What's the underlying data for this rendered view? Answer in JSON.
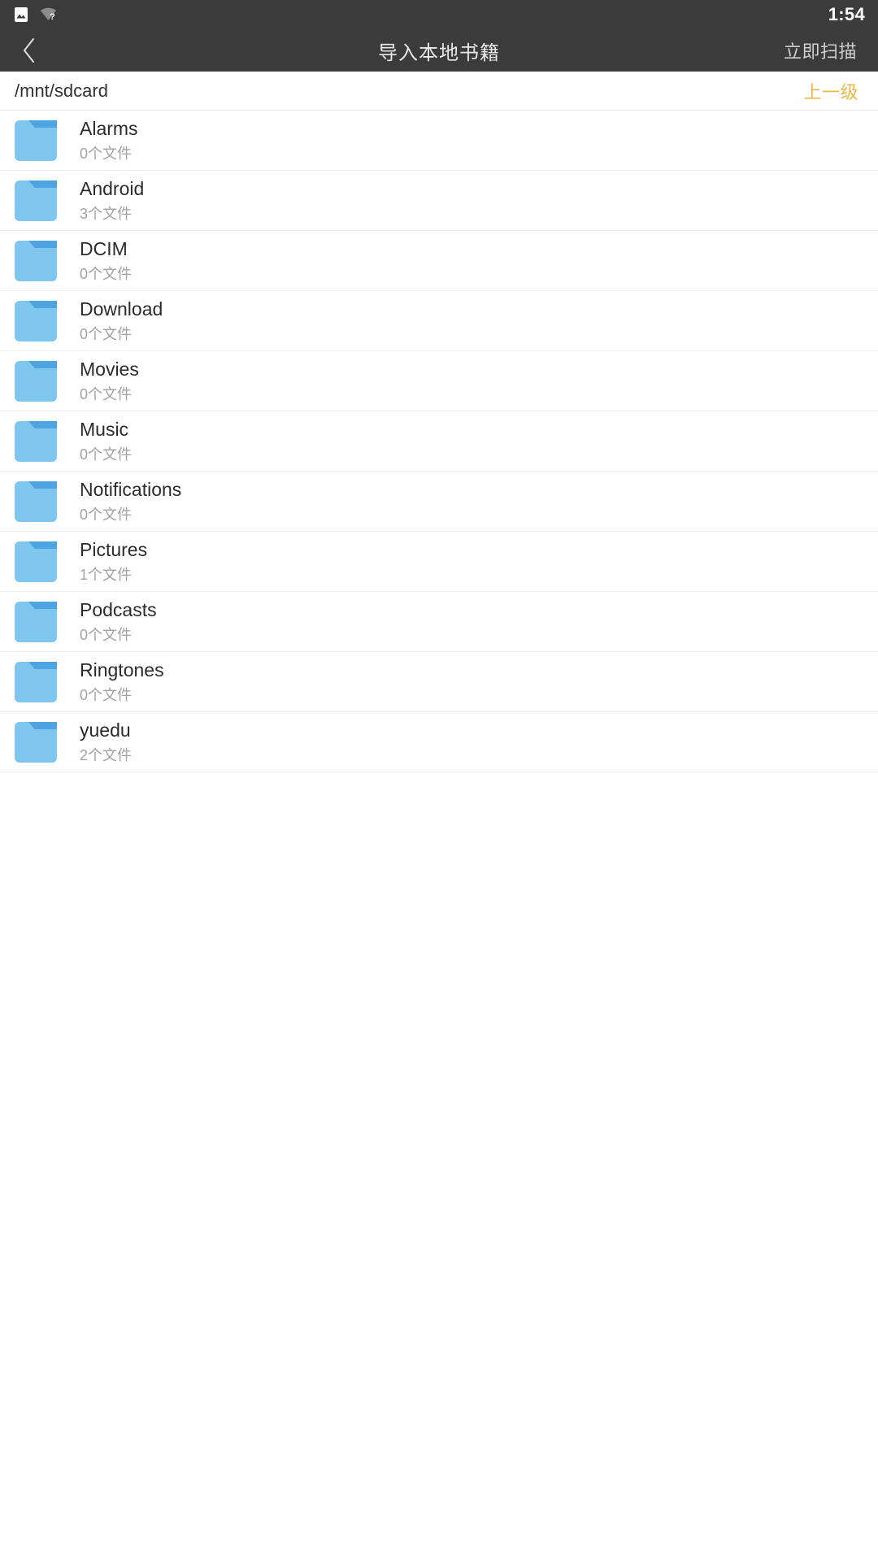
{
  "status_bar": {
    "icons": [
      {
        "name": "photo-icon",
        "label": "image"
      },
      {
        "name": "wifi-question-icon",
        "label": "wifi-unknown"
      }
    ],
    "time": "1:54"
  },
  "app_bar": {
    "back_icon": "chevron-left-icon",
    "title": "导入本地书籍",
    "action_label": "立即扫描"
  },
  "path_bar": {
    "path": "/mnt/sdcard",
    "up_label": "上一级"
  },
  "colors": {
    "bar_background": "#3b3b3b",
    "accent": "#e8b84b",
    "folder_body": "#7fc6ef",
    "folder_tab": "#4da4e0",
    "page_background": "#ffffff",
    "divider": "#ededed",
    "primary_text": "#2b2b2b",
    "secondary_text": "#a2a2a2"
  },
  "file_list": {
    "icon_name": "folder-icon",
    "items": [
      {
        "name": "Alarms",
        "count": "0个文件"
      },
      {
        "name": "Android",
        "count": "3个文件"
      },
      {
        "name": "DCIM",
        "count": "0个文件"
      },
      {
        "name": "Download",
        "count": "0个文件"
      },
      {
        "name": "Movies",
        "count": "0个文件"
      },
      {
        "name": "Music",
        "count": "0个文件"
      },
      {
        "name": "Notifications",
        "count": "0个文件"
      },
      {
        "name": "Pictures",
        "count": "1个文件"
      },
      {
        "name": "Podcasts",
        "count": "0个文件"
      },
      {
        "name": "Ringtones",
        "count": "0个文件"
      },
      {
        "name": "yuedu",
        "count": "2个文件"
      }
    ]
  }
}
